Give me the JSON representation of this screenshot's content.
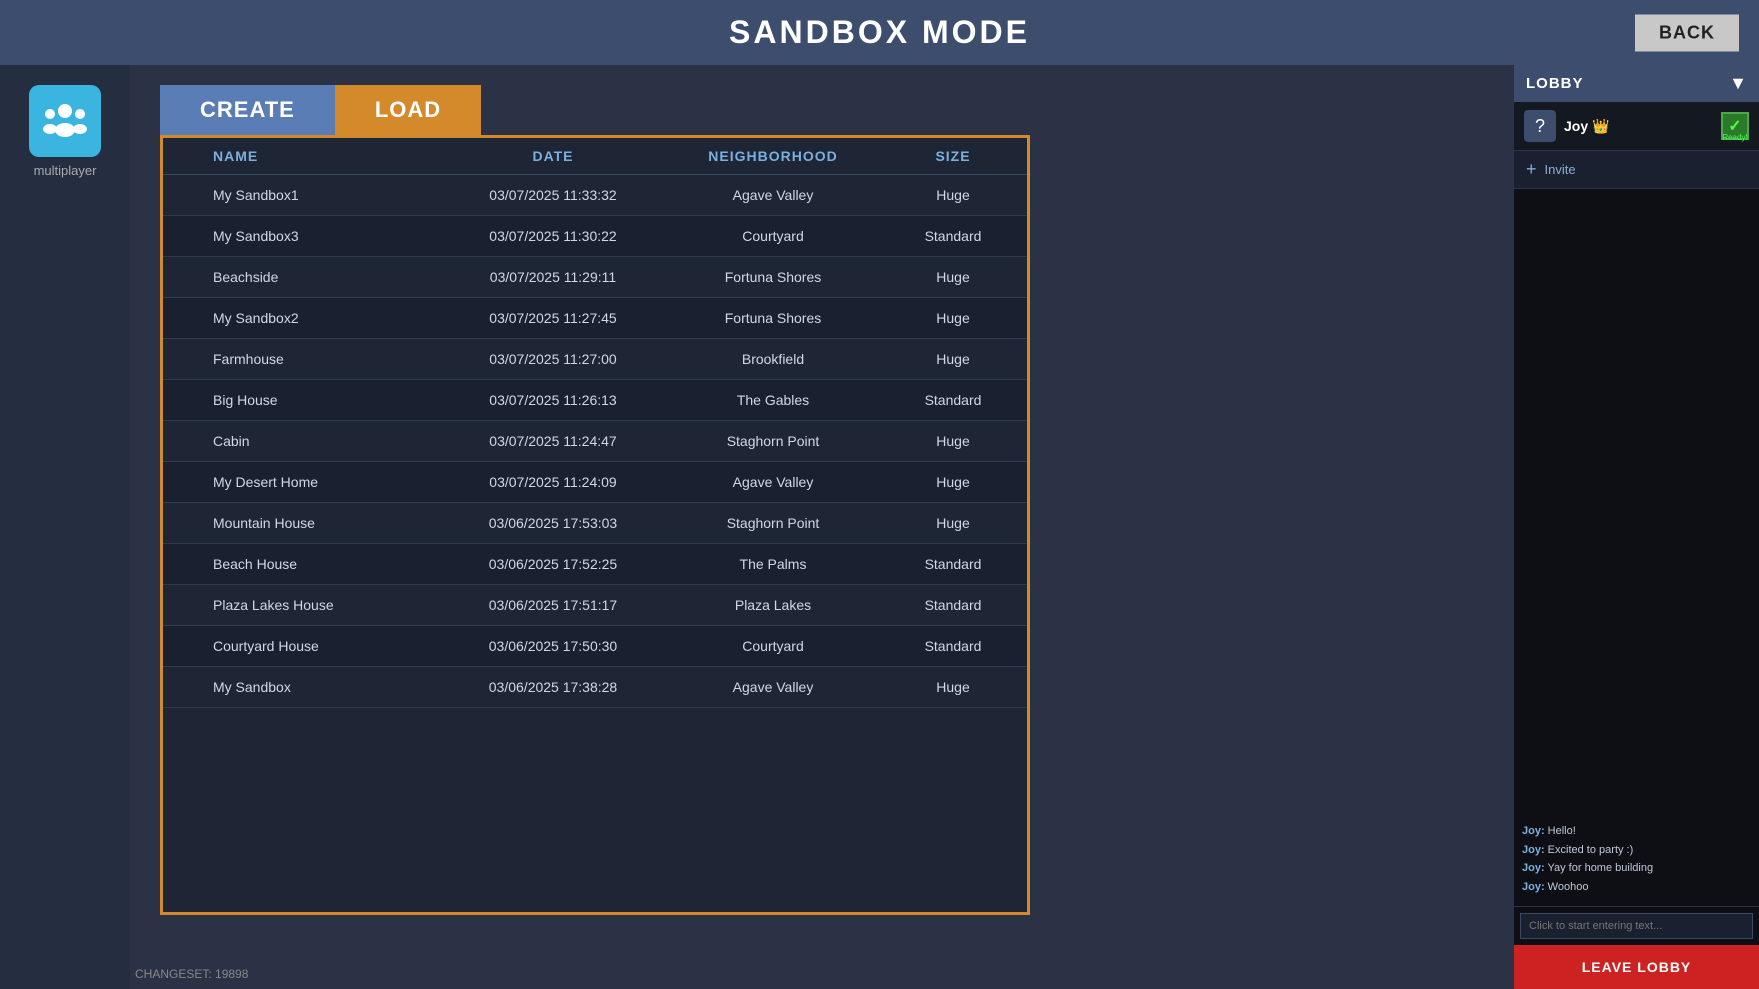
{
  "header": {
    "title": "SANDBOX MODE",
    "back_label": "BACK"
  },
  "sidebar": {
    "multiplayer_label": "multiplayer"
  },
  "tabs": {
    "create_label": "CREATE",
    "load_label": "LOAD"
  },
  "table": {
    "columns": [
      "NAME",
      "DATE",
      "NEIGHBORHOOD",
      "SIZE"
    ],
    "rows": [
      {
        "name": "My Sandbox1",
        "date": "03/07/2025  11:33:32",
        "neighborhood": "Agave Valley",
        "size": "Huge"
      },
      {
        "name": "My Sandbox3",
        "date": "03/07/2025  11:30:22",
        "neighborhood": "Courtyard",
        "size": "Standard"
      },
      {
        "name": "Beachside",
        "date": "03/07/2025  11:29:11",
        "neighborhood": "Fortuna Shores",
        "size": "Huge"
      },
      {
        "name": "My Sandbox2",
        "date": "03/07/2025  11:27:45",
        "neighborhood": "Fortuna Shores",
        "size": "Huge"
      },
      {
        "name": "Farmhouse",
        "date": "03/07/2025  11:27:00",
        "neighborhood": "Brookfield",
        "size": "Huge"
      },
      {
        "name": "Big House",
        "date": "03/07/2025  11:26:13",
        "neighborhood": "The Gables",
        "size": "Standard"
      },
      {
        "name": "Cabin",
        "date": "03/07/2025  11:24:47",
        "neighborhood": "Staghorn Point",
        "size": "Huge"
      },
      {
        "name": "My Desert Home",
        "date": "03/07/2025  11:24:09",
        "neighborhood": "Agave Valley",
        "size": "Huge"
      },
      {
        "name": "Mountain House",
        "date": "03/06/2025  17:53:03",
        "neighborhood": "Staghorn Point",
        "size": "Huge"
      },
      {
        "name": "Beach House",
        "date": "03/06/2025  17:52:25",
        "neighborhood": "The Palms",
        "size": "Standard"
      },
      {
        "name": "Plaza Lakes House",
        "date": "03/06/2025  17:51:17",
        "neighborhood": "Plaza Lakes",
        "size": "Standard"
      },
      {
        "name": "Courtyard House",
        "date": "03/06/2025  17:50:30",
        "neighborhood": "Courtyard",
        "size": "Standard"
      },
      {
        "name": "My Sandbox",
        "date": "03/06/2025  17:38:28",
        "neighborhood": "Agave Valley",
        "size": "Huge"
      }
    ]
  },
  "lobby": {
    "title": "LOBBY",
    "player": {
      "name": "Joy",
      "ready_text": "Ready!"
    },
    "invite_label": "Invite",
    "chat_messages": [
      {
        "sender": "Joy",
        "text": "Hello!"
      },
      {
        "sender": "Joy",
        "text": "Excited to party :)"
      },
      {
        "sender": "Joy",
        "text": "Yay for home building"
      },
      {
        "sender": "Joy",
        "text": "Woohoo"
      }
    ],
    "chat_placeholder": "Click to start entering text...",
    "leave_label": "LEAVE LOBBY"
  },
  "footer": {
    "changeset": "CHANGESET: 19898"
  }
}
